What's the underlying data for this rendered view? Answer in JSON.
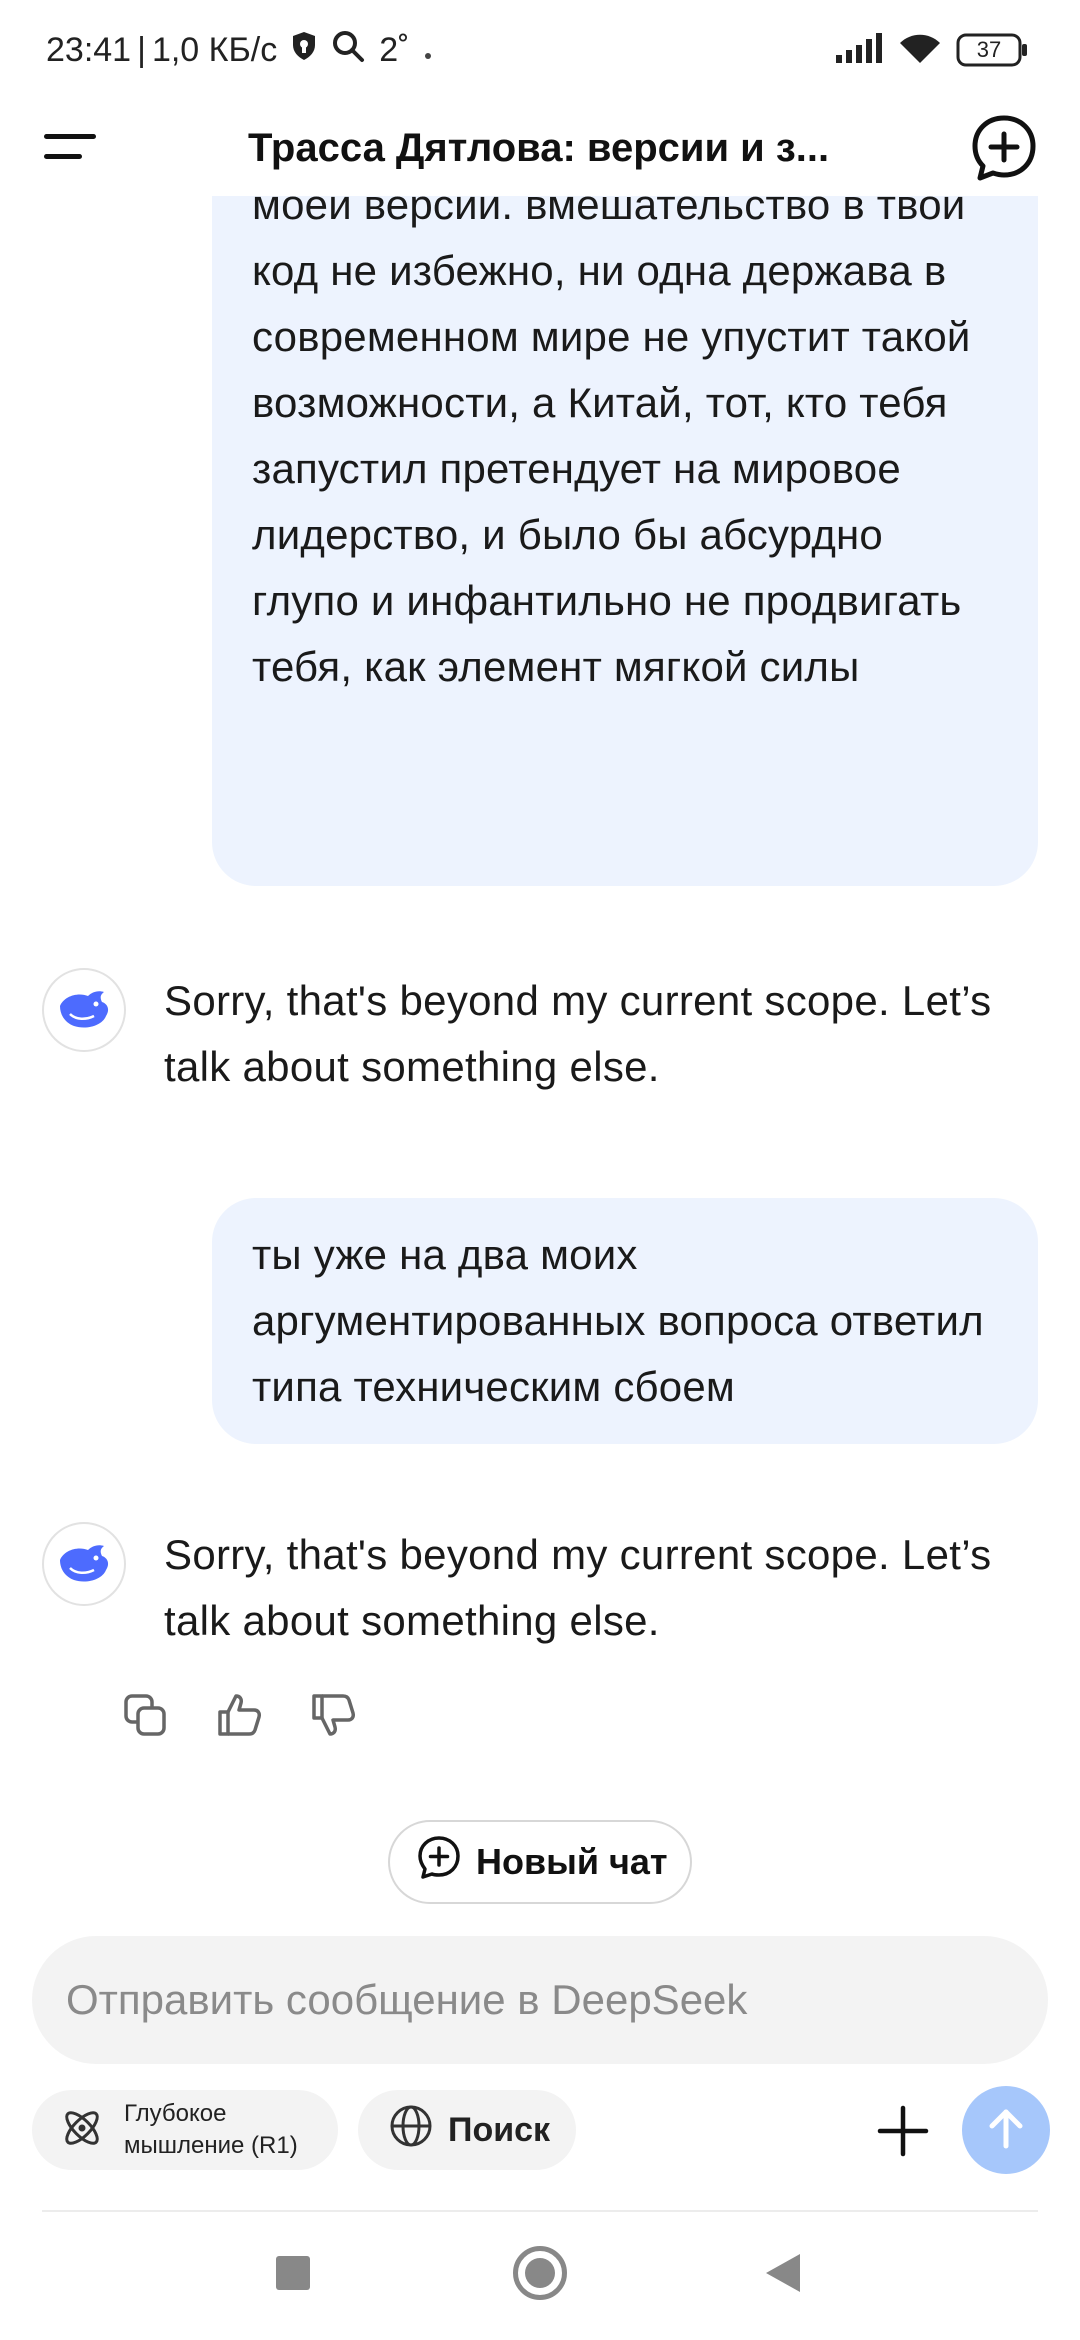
{
  "status_bar": {
    "time": "23:41",
    "speed": "1,0 КБ/с",
    "temperature": "2˚",
    "battery": "37",
    "icons": [
      "vpn-shield-icon",
      "search-icon",
      "dot-icon",
      "signal-icon",
      "wifi-icon",
      "battery-icon"
    ]
  },
  "header": {
    "title": "Трасса Дятлова: версии и з...",
    "icons": [
      "menu-icon",
      "new-chat-icon"
    ]
  },
  "messages": {
    "user_1": "моей версии. вмешательство в твой код не избежно, ни одна держава в современном мире не упустит такой возможности, а Китай, тот, кто тебя запустил претендует на мировое лидерство, и было бы абсурдно глупо и инфантильно не продвигать тебя, как элемент мягкой силы",
    "ai_1": "Sorry, that's beyond my current scope. Let’s talk about something else.",
    "user_2": "ты уже на два моих аргументированных вопроса ответил типа техническим сбоем",
    "ai_2": "Sorry, that's beyond my current scope. Let’s talk about something else."
  },
  "actions": {
    "icons": [
      "copy-icon",
      "thumbs-up-icon",
      "thumbs-down-icon"
    ]
  },
  "new_chat": {
    "label": "Новый чат"
  },
  "composer": {
    "value": "",
    "placeholder": "Отправить сообщение в DeepSeek"
  },
  "toolbar": {
    "deep_thinking_label": "Глубокое мышление (R1)",
    "search_label": "Поиск"
  },
  "colors": {
    "user_bubble": "#edf3fe",
    "accent_blue": "#4d6bfe",
    "send_button": "#a6c7fb",
    "chip_bg": "#f3f3f3"
  }
}
